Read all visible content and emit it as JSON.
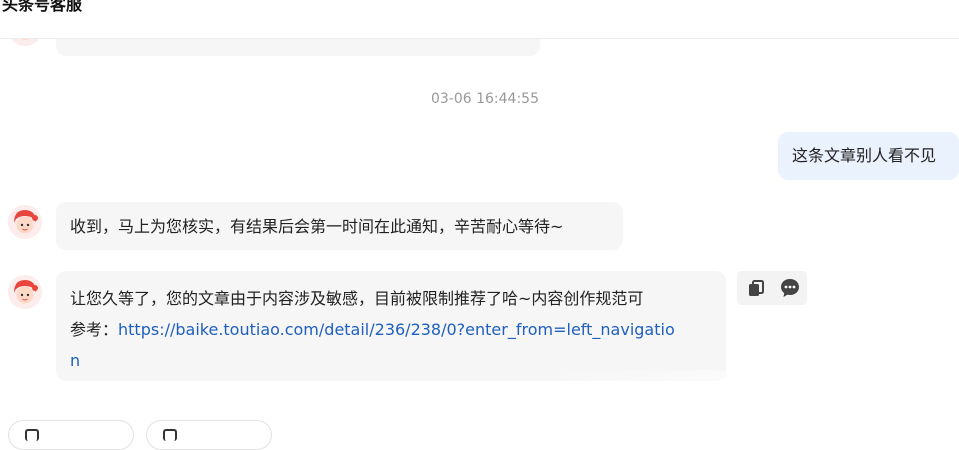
{
  "header": {
    "title": "头条号客服"
  },
  "messages": {
    "partial_top": {
      "text": ""
    },
    "timestamp": "03-06 16:44:55",
    "user_msg": {
      "text": "这条文章别人看不见"
    },
    "reply1": {
      "text": "收到，马上为您核实，有结果后会第一时间在此通知，辛苦耐心等待~"
    },
    "reply2": {
      "line1": "让您久等了，您的文章由于内容涉及敏感，目前被限制推荐了哈~内容创作规范可",
      "line2_prefix": "参考：",
      "link_part1": "https://baike.toutiao.com/detail/236/238/0?enter_from=left_navigatio",
      "link_part2": "n"
    }
  },
  "icons": {
    "avatar": "cartoon-girl-avatar-icon",
    "copy": "copy-icon",
    "comment": "comment-dots-icon"
  },
  "colors": {
    "incoming_bubble": "#f6f6f6",
    "outgoing_bubble": "#eaf2fe",
    "link": "#1f5fbf",
    "timestamp": "#999999"
  }
}
